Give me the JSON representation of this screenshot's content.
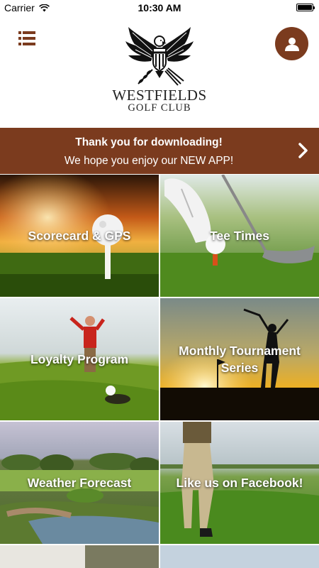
{
  "status_bar": {
    "carrier": "Carrier",
    "time": "10:30 AM"
  },
  "header": {
    "logo_line1": "WESTFIELDS",
    "logo_line2": "GOLF CLUB",
    "brand_color": "#7b3b1e"
  },
  "banner": {
    "title": "Thank you for downloading!",
    "subtitle": "We hope you enjoy our NEW APP!"
  },
  "tiles": [
    {
      "label": "Scorecard & GPS"
    },
    {
      "label": "Tee Times"
    },
    {
      "label": "Loyalty Program"
    },
    {
      "label": "Monthly Tournament Series"
    },
    {
      "label": "Weather Forecast"
    },
    {
      "label": "Like us on Facebook!"
    }
  ]
}
